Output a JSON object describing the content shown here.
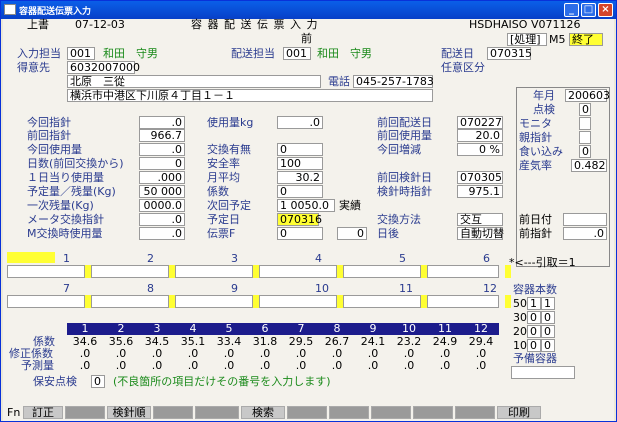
{
  "window": {
    "title": "容器配送伝票入力"
  },
  "header": {
    "mode": "上書",
    "date": "07-12-03",
    "screen_title": "容 器 配 送 伝 票 入 力",
    "sub": "前",
    "terminal": "HSDHAISO",
    "version": "V071126",
    "status": "[処理]",
    "status2": "M5",
    "end": "終了"
  },
  "info": {
    "input_staff_label": "入力担当",
    "input_staff_code": "001",
    "input_staff_name": "和田　守男",
    "delivery_staff_label": "配送担当",
    "delivery_staff_code": "001",
    "delivery_staff_name": "和田　守男",
    "delivery_date_label": "配送日",
    "delivery_date": "070315",
    "customer_label": "得意先",
    "customer_code": "6032007000",
    "optional_label": "任意区分",
    "customer_name": "北原　三從",
    "phone_label": "電話",
    "phone": "045-257-1783",
    "address": "横浜市中港区下川原４丁目１－１"
  },
  "right_panel": {
    "ym_label": "年月",
    "ym": "200603",
    "inspect_label": "点検",
    "inspect": "0",
    "monitor_label": "モニタ",
    "meter_label": "親指針",
    "bite_label": "食い込み",
    "bite": "0",
    "vapor_label": "産気率",
    "vapor": "0.482"
  },
  "col1": [
    {
      "label": "今回指針",
      "value": ".0"
    },
    {
      "label": "前回指針",
      "value": "966.7"
    },
    {
      "label": "今回使用量",
      "value": ".0"
    },
    {
      "label": "日数(前回交換から)",
      "value": "0"
    },
    {
      "label": "１日当り使用量",
      "value": ".000"
    },
    {
      "label": "予定量／残量(Kg)",
      "value": "50 000"
    },
    {
      "label": "一次残量(Kg)",
      "value": "0000.0"
    },
    {
      "label": "メータ交換指針",
      "value": ".0"
    },
    {
      "label": "M交換時使用量",
      "value": ".0"
    }
  ],
  "col2": [
    {
      "label": "使用量kg",
      "value": ".0"
    },
    {
      "label": "交換有無",
      "value": "0"
    },
    {
      "label": "安全率",
      "value": "100"
    },
    {
      "label": "月平均",
      "value": "30.2"
    },
    {
      "label": "係数",
      "value": "0"
    },
    {
      "label": "次回予定",
      "value": "1 0050.0"
    },
    {
      "label": "予定日",
      "value": "070316"
    },
    {
      "label": "伝票F",
      "value": "0"
    }
  ],
  "col2_extra": {
    "actual": "実績",
    "slip_f2": "0"
  },
  "col3": [
    {
      "label": "前回配送日",
      "value": "070227"
    },
    {
      "label": "前回使用量",
      "value": "20.0"
    },
    {
      "label": "今回増減",
      "value": "0 %"
    },
    {
      "label": "前回検針日",
      "value": "070305"
    },
    {
      "label": "検針時指針",
      "value": "975.1"
    },
    {
      "label": "交換方法",
      "value": "交互"
    },
    {
      "label": "日後",
      "value": "自動切替"
    }
  ],
  "col4": [
    {
      "label": "前日付",
      "value": ""
    },
    {
      "label": "前指針",
      "value": ".0"
    }
  ],
  "slots": {
    "row1": [
      "1",
      "2",
      "3",
      "4",
      "5",
      "6"
    ],
    "row2": [
      "7",
      "8",
      "9",
      "10",
      "11",
      "12"
    ],
    "pull_label": "*<---引取＝1"
  },
  "containers": {
    "title": "容器本数",
    "rows": [
      {
        "size": "50",
        "a": "1",
        "b": "1"
      },
      {
        "size": "30",
        "a": "0",
        "b": "0"
      },
      {
        "size": "20",
        "a": "0",
        "b": "0"
      },
      {
        "size": "10",
        "a": "0",
        "b": "0"
      }
    ],
    "spare_label": "予備容器"
  },
  "grid": {
    "headers": [
      "1",
      "2",
      "3",
      "4",
      "5",
      "6",
      "7",
      "8",
      "9",
      "10",
      "11",
      "12"
    ],
    "row_labels": [
      "係数",
      "修正係数",
      "予測量"
    ],
    "coef": [
      "34.6",
      "35.6",
      "34.5",
      "35.1",
      "33.4",
      "31.8",
      "29.5",
      "26.7",
      "24.1",
      "23.2",
      "24.9",
      "29.4"
    ],
    "corr": [
      ".0",
      ".0",
      ".0",
      ".0",
      ".0",
      ".0",
      ".0",
      ".0",
      ".0",
      ".0",
      ".0",
      ".0"
    ],
    "pred": [
      ".0",
      ".0",
      ".0",
      ".0",
      ".0",
      ".0",
      ".0",
      ".0",
      ".0",
      ".0",
      ".0",
      ".0"
    ]
  },
  "safety": {
    "label": "保安点検",
    "value": "0",
    "note": "(不良箇所の項目だけその番号を入力します)"
  },
  "fkeys": {
    "fn": "Fn",
    "keys": [
      "訂正",
      "",
      "検針順",
      "",
      "",
      "検索",
      "",
      "",
      "",
      "",
      "",
      "印刷"
    ]
  }
}
